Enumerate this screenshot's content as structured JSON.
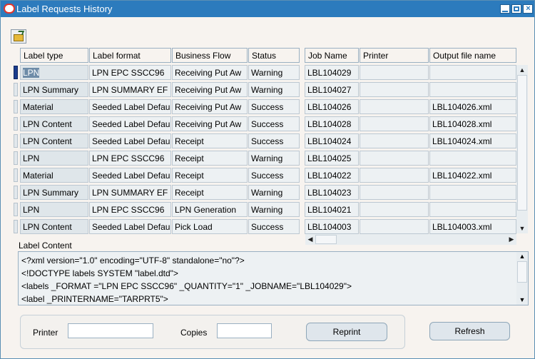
{
  "window": {
    "title": "Label Requests History",
    "controls": {
      "minimize": "minimize-icon",
      "maximize": "maximize-icon",
      "close": "close-icon"
    }
  },
  "toolbar": {
    "open_icon": "open-folder-icon"
  },
  "table": {
    "headers": {
      "label_type": "Label type",
      "label_format": "Label format",
      "business_flow": "Business Flow",
      "status": "Status",
      "job_name": "Job Name",
      "printer": "Printer",
      "output_file": "Output file name"
    },
    "rows": [
      {
        "label_type": "LPN",
        "label_format": "LPN EPC SSCC96",
        "business_flow": "Receiving Put Aw",
        "status": "Warning",
        "job_name": "LBL104029",
        "printer": "",
        "output_file": ""
      },
      {
        "label_type": "LPN Summary",
        "label_format": "LPN SUMMARY EF",
        "business_flow": "Receiving Put Aw",
        "status": "Warning",
        "job_name": "LBL104027",
        "printer": "",
        "output_file": ""
      },
      {
        "label_type": "Material",
        "label_format": "Seeded Label Defau",
        "business_flow": "Receiving Put Aw",
        "status": "Success",
        "job_name": "LBL104026",
        "printer": "",
        "output_file": "LBL104026.xml"
      },
      {
        "label_type": "LPN Content",
        "label_format": "Seeded Label Defau",
        "business_flow": "Receiving Put Aw",
        "status": "Success",
        "job_name": "LBL104028",
        "printer": "",
        "output_file": "LBL104028.xml"
      },
      {
        "label_type": "LPN Content",
        "label_format": "Seeded Label Defau",
        "business_flow": "Receipt",
        "status": "Success",
        "job_name": "LBL104024",
        "printer": "",
        "output_file": "LBL104024.xml"
      },
      {
        "label_type": "LPN",
        "label_format": "LPN EPC SSCC96",
        "business_flow": "Receipt",
        "status": "Warning",
        "job_name": "LBL104025",
        "printer": "",
        "output_file": ""
      },
      {
        "label_type": "Material",
        "label_format": "Seeded Label Defau",
        "business_flow": "Receipt",
        "status": "Success",
        "job_name": "LBL104022",
        "printer": "",
        "output_file": "LBL104022.xml"
      },
      {
        "label_type": "LPN Summary",
        "label_format": "LPN SUMMARY EF",
        "business_flow": "Receipt",
        "status": "Warning",
        "job_name": "LBL104023",
        "printer": "",
        "output_file": ""
      },
      {
        "label_type": "LPN",
        "label_format": "LPN EPC SSCC96",
        "business_flow": "LPN Generation",
        "status": "Warning",
        "job_name": "LBL104021",
        "printer": "",
        "output_file": ""
      },
      {
        "label_type": "LPN Content",
        "label_format": "Seeded Label Defau",
        "business_flow": "Pick Load",
        "status": "Success",
        "job_name": "LBL104003",
        "printer": "",
        "output_file": "LBL104003.xml"
      }
    ]
  },
  "label_content": {
    "label": "Label Content",
    "lines": [
      "<?xml version=\"1.0\" encoding=\"UTF-8\" standalone=\"no\"?>",
      "<!DOCTYPE labels SYSTEM \"label.dtd\">",
      "<labels _FORMAT =\"LPN EPC SSCC96\" _QUANTITY=\"1\" _JOBNAME=\"LBL104029\">",
      "<label _PRINTERNAME=\"TARPRT5\">"
    ]
  },
  "footer": {
    "printer_label": "Printer",
    "printer_value": "",
    "copies_label": "Copies",
    "copies_value": "",
    "reprint_label": "Reprint",
    "refresh_label": "Refresh"
  },
  "colors": {
    "titlebar": "#2c7bbd",
    "selected_row_marker": "#1b3c8c"
  }
}
